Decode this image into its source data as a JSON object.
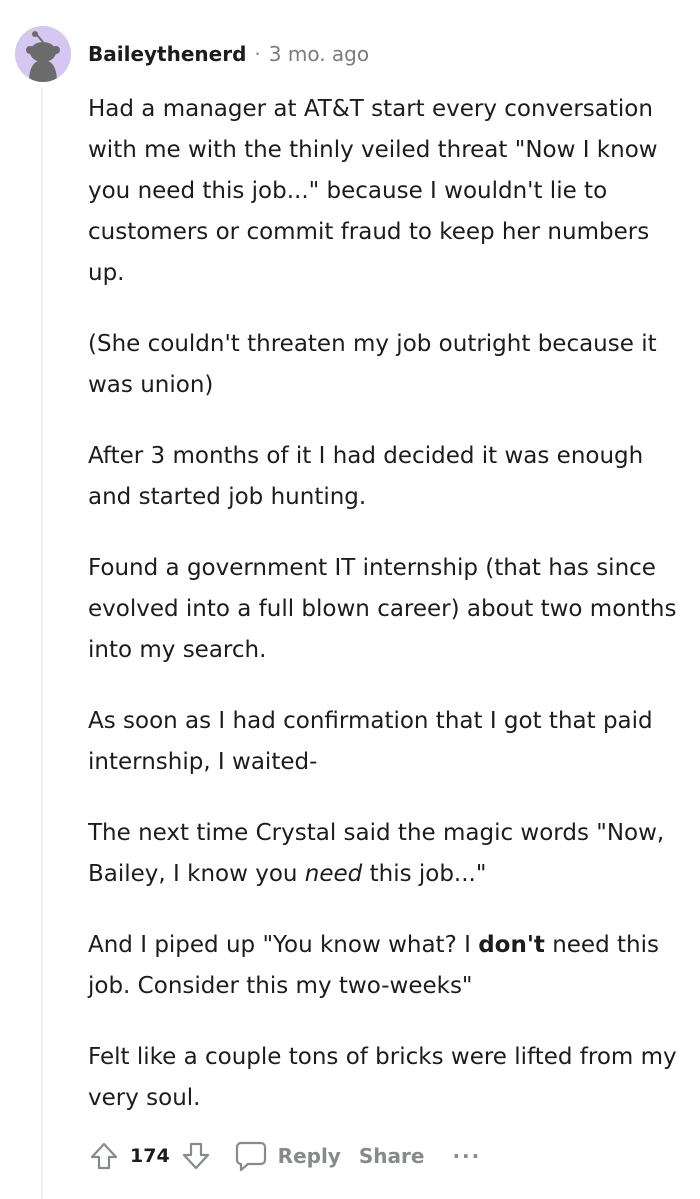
{
  "comment": {
    "author": "Baileythenerd",
    "separator": "·",
    "age": "3 mo. ago",
    "paragraphs": [
      {
        "segments": [
          {
            "text": "Had a manager at AT&T start every conversation with me with the thinly veiled threat \"Now I know you need this job...\" because I wouldn't lie to customers or commit fraud to keep her numbers up."
          }
        ]
      },
      {
        "segments": [
          {
            "text": "(She couldn't threaten my job outright because it was union)"
          }
        ]
      },
      {
        "segments": [
          {
            "text": "After 3 months of it I had decided it was enough and started job hunting."
          }
        ]
      },
      {
        "segments": [
          {
            "text": "Found a government IT internship (that has since evolved into a full blown career) about two months into my search."
          }
        ]
      },
      {
        "segments": [
          {
            "text": "As soon as I had confirmation that I got that paid internship, I waited-"
          }
        ]
      },
      {
        "segments": [
          {
            "text": "The next time Crystal said the magic words \"Now, Bailey, I know you "
          },
          {
            "text": "need",
            "style": "italic"
          },
          {
            "text": " this job...\""
          }
        ]
      },
      {
        "segments": [
          {
            "text": "And I piped up \"You know what? I "
          },
          {
            "text": "don't",
            "style": "bold"
          },
          {
            "text": " need this job. Consider this my two-weeks\""
          }
        ]
      },
      {
        "segments": [
          {
            "text": "Felt like a couple tons of bricks were lifted from my very soul."
          }
        ]
      }
    ]
  },
  "actions": {
    "score": "174",
    "reply_label": "Reply",
    "share_label": "Share",
    "more_label": "···"
  },
  "icons": {
    "avatar": "snoo-avatar-icon",
    "upvote": "upvote-arrow-icon",
    "downvote": "downvote-arrow-icon",
    "reply": "speech-bubble-icon"
  },
  "colors": {
    "avatar_bg": "#d4c8f2",
    "avatar_figure": "#6b6b6b",
    "meta_gray": "#878a8c",
    "text": "#1c1c1c"
  }
}
